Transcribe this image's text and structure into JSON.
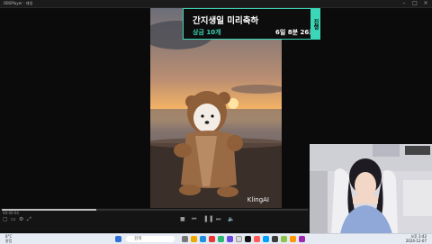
{
  "window": {
    "title": "OBSPlayer - 재생",
    "minimize_icon": "minimize-icon",
    "maximize_icon": "maximize-icon",
    "close_icon": "close-icon"
  },
  "overlay": {
    "title": "간지생일 미리축하",
    "reward": "상금 10개",
    "timer": "6일 8분 26초",
    "badge": "진행",
    "accent_color": "#3bd6b7"
  },
  "video": {
    "watermark": "KlingAI"
  },
  "player": {
    "time": "00:00:04",
    "progress": 0.31
  },
  "taskbar": {
    "weather": "8°C",
    "weather_sub": "맑음",
    "search_placeholder": "검색",
    "clock_time": "오후 3:42",
    "clock_date": "2024-12-07"
  }
}
